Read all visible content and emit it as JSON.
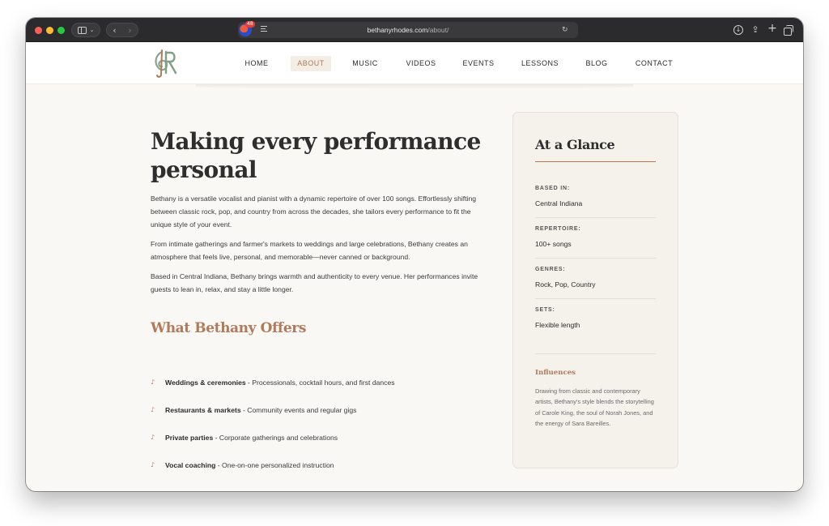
{
  "browser": {
    "url_domain": "bethanyrhodes.com",
    "url_path": "/about/",
    "extension_badge": "48",
    "icons": [
      "sidebar-icon",
      "back-icon",
      "forward-icon",
      "reader-icon",
      "reload-icon",
      "download-icon",
      "share-icon",
      "new-tab-icon",
      "tabs-overview-icon"
    ]
  },
  "nav": {
    "items": [
      {
        "label": "HOME"
      },
      {
        "label": "ABOUT",
        "active": true
      },
      {
        "label": "MUSIC"
      },
      {
        "label": "VIDEOS"
      },
      {
        "label": "EVENTS"
      },
      {
        "label": "LESSONS"
      },
      {
        "label": "BLOG"
      },
      {
        "label": "CONTACT"
      }
    ]
  },
  "main": {
    "title": "Making every performance personal",
    "paragraphs": [
      "Bethany is a versatile vocalist and pianist with a dynamic repertoire of over 100 songs. Effortlessly shifting between classic rock, pop, and country from across the decades, she tailors every performance to fit the unique style of your event.",
      "From intimate gatherings and farmer's markets to weddings and large celebrations, Bethany creates an atmosphere that feels live, personal, and memorable—never canned or background.",
      "Based in Central Indiana, Bethany brings warmth and authenticity to every venue. Her performances invite guests to lean in, relax, and stay a little longer."
    ],
    "offers_title": "What Bethany Offers",
    "bullet": "♪",
    "offers": [
      {
        "name": "Weddings & ceremonies",
        "desc": " - Processionals, cocktail hours, and first dances"
      },
      {
        "name": "Restaurants & markets",
        "desc": " - Community events and regular gigs"
      },
      {
        "name": "Private parties",
        "desc": " - Corporate gatherings and celebrations"
      },
      {
        "name": "Vocal coaching",
        "desc": " - One-on-one personalized instruction"
      }
    ]
  },
  "sidebar": {
    "title": "At a Glance",
    "facts": [
      {
        "label": "BASED IN:",
        "value": "Central Indiana"
      },
      {
        "label": "REPERTOIRE:",
        "value": "100+ songs"
      },
      {
        "label": "GENRES:",
        "value": "Rock, Pop, Country"
      },
      {
        "label": "SETS:",
        "value": "Flexible length"
      }
    ],
    "influences_title": "Influences",
    "influences_text": "Drawing from classic and contemporary artists, Bethany's style blends the storytelling of Carole King, the soul of Norah Jones, and the energy of Sara Bareilles."
  },
  "colors": {
    "accent": "#b07a5b",
    "rule": "#c0714f",
    "text": "#2e2e2e",
    "page_bg": "#faf8f5",
    "card_bg": "#f5f2ec"
  }
}
